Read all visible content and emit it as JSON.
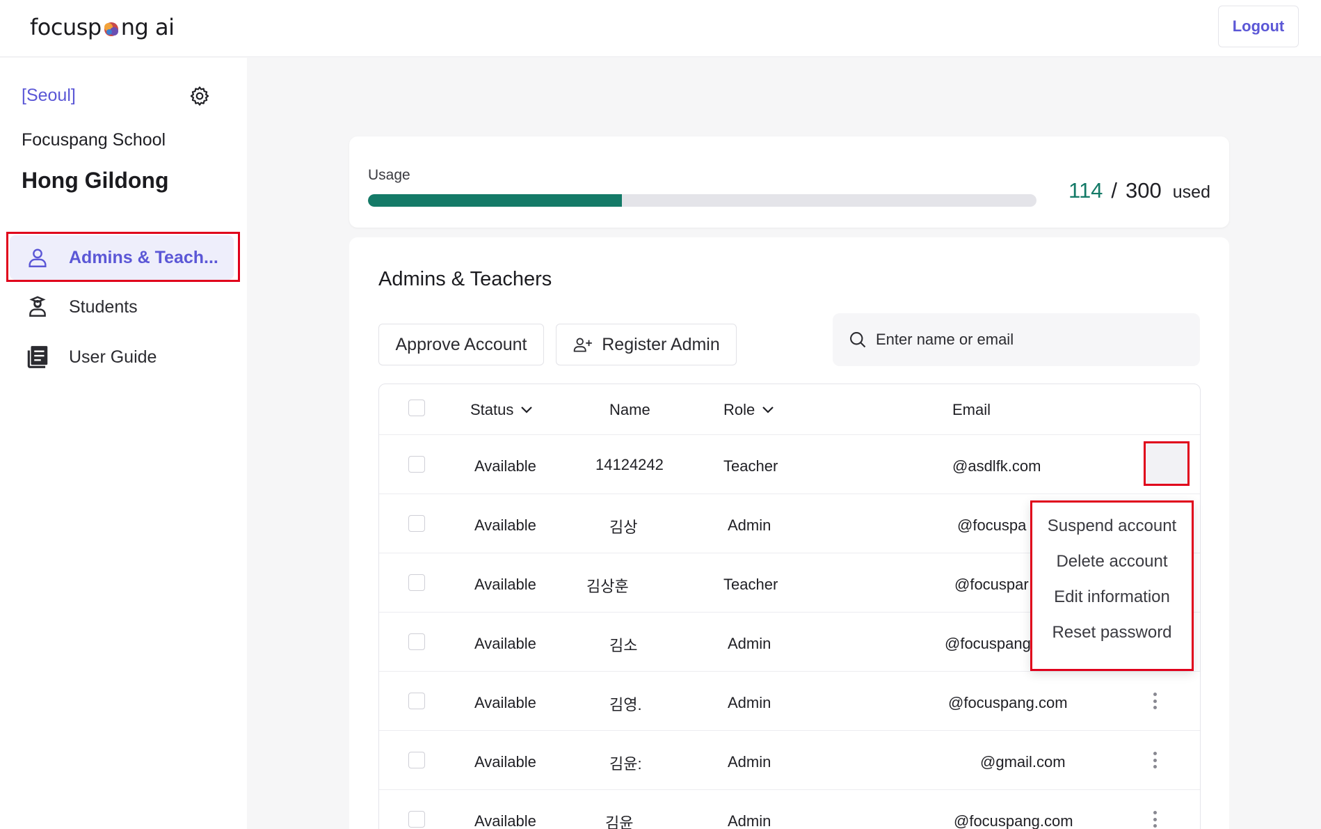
{
  "header": {
    "logo_left": "focusp",
    "logo_right": "ng ai",
    "logout_label": "Logout"
  },
  "sidebar": {
    "region": "[Seoul]",
    "school": "Focuspang School",
    "user": "Hong Gildong",
    "items": [
      {
        "label": "Admins & Teach...",
        "icon": "person-icon",
        "active": true
      },
      {
        "label": "Students",
        "icon": "student-icon",
        "active": false
      },
      {
        "label": "User Guide",
        "icon": "book-icon",
        "active": false
      }
    ]
  },
  "usage": {
    "label": "Usage",
    "used": "114",
    "separator": "/",
    "total": "300",
    "suffix": "used",
    "fraction": 0.38
  },
  "main": {
    "title": "Admins & Teachers",
    "approve_label": "Approve Account",
    "register_label": "Register Admin",
    "search_placeholder": "Enter name or email",
    "columns": {
      "status": "Status",
      "name": "Name",
      "role": "Role",
      "email": "Email"
    },
    "rows": [
      {
        "status": "Available",
        "name": "14124242",
        "role": "Teacher",
        "email": "@asdlfk.com"
      },
      {
        "status": "Available",
        "name": "김상",
        "role": "Admin",
        "email": "@focuspa"
      },
      {
        "status": "Available",
        "name": "김상훈",
        "role": "Teacher",
        "email": "@focuspar"
      },
      {
        "status": "Available",
        "name": "김소",
        "role": "Admin",
        "email": "@focuspang"
      },
      {
        "status": "Available",
        "name": "김영.",
        "role": "Admin",
        "email": "@focuspang.com"
      },
      {
        "status": "Available",
        "name": "김윤:",
        "role": "Admin",
        "email": "@gmail.com"
      },
      {
        "status": "Available",
        "name": "김윤",
        "role": "Admin",
        "email": "@focuspang.com"
      }
    ]
  },
  "menu": {
    "items": [
      "Suspend account",
      "Delete account",
      "Edit information",
      "Reset password"
    ]
  },
  "colors": {
    "accent": "#5b57d6",
    "progress": "#147a67",
    "highlight": "#e0001b"
  }
}
